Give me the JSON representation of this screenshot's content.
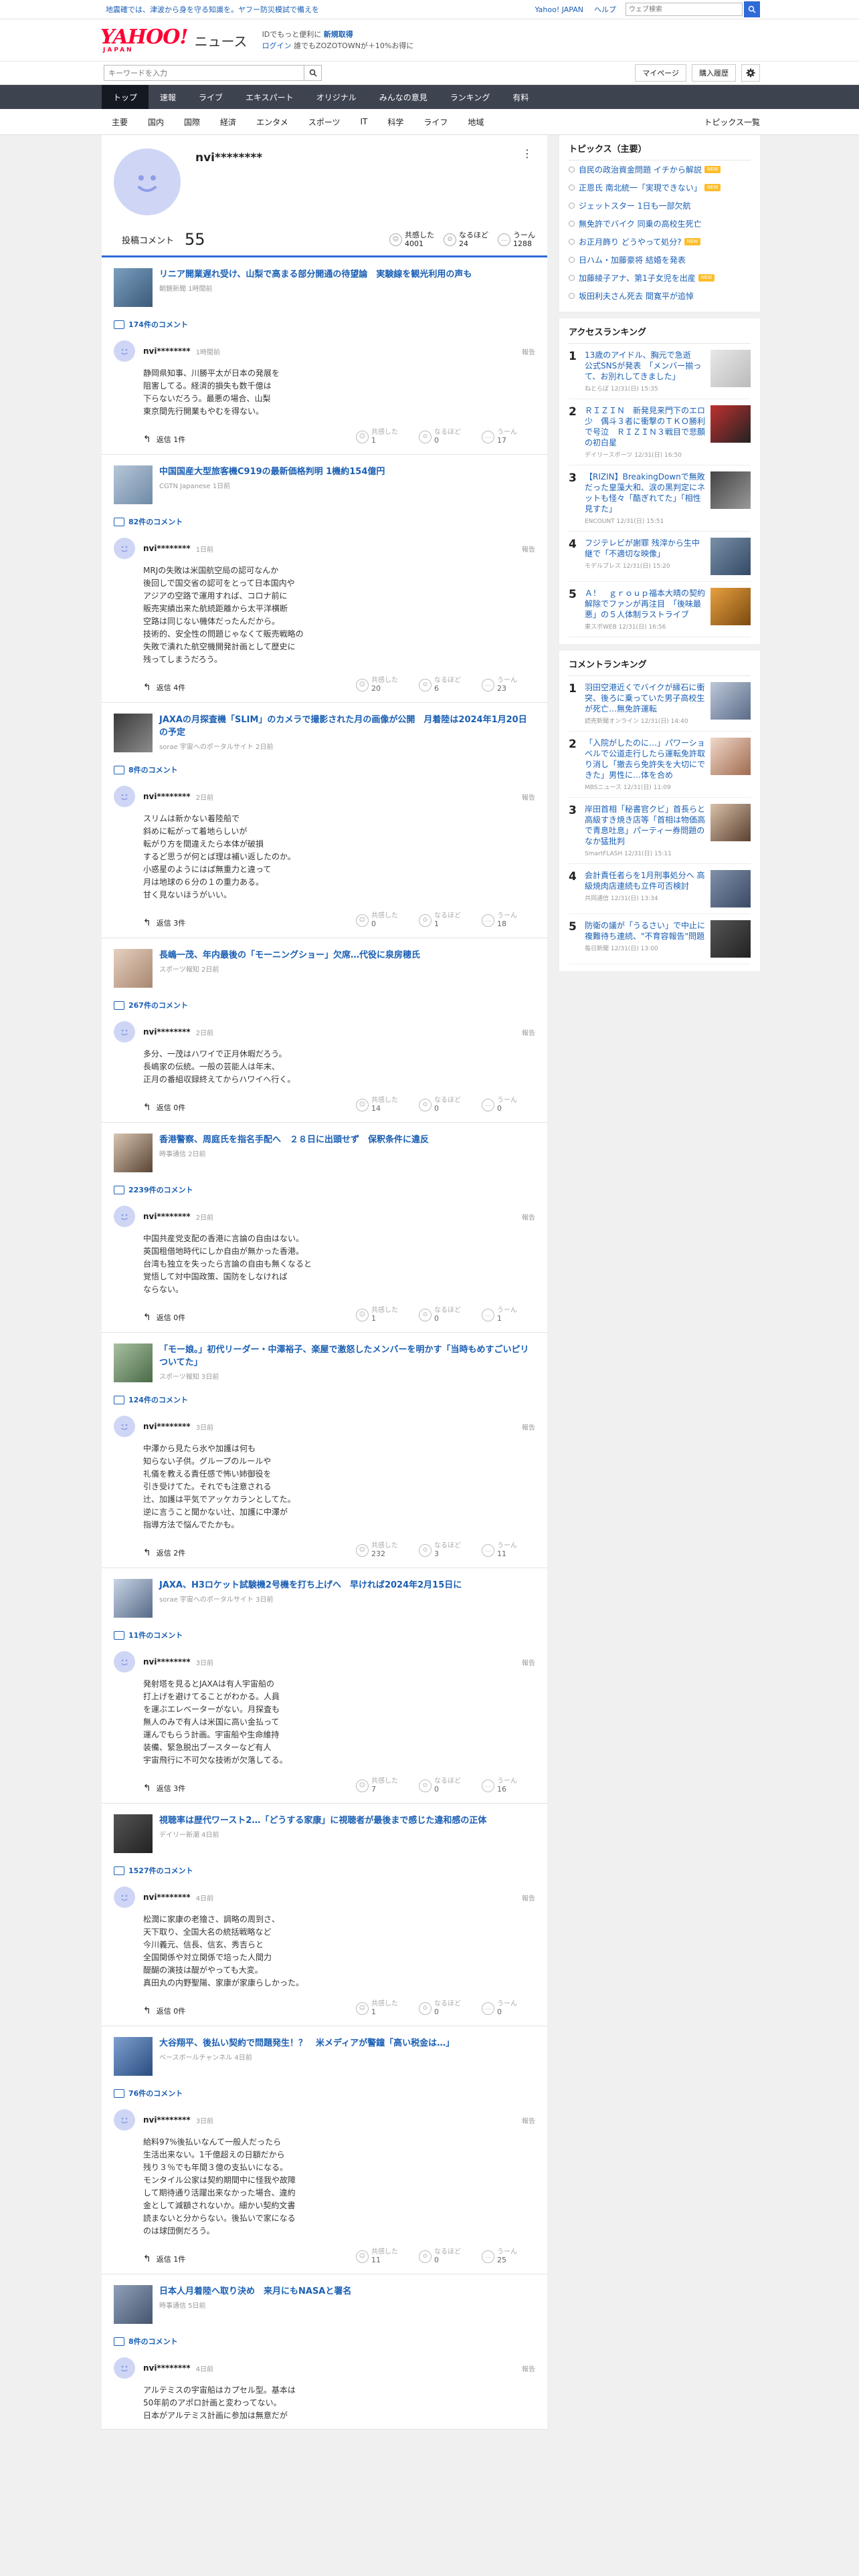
{
  "topbar": {
    "alert": "地震確では、津波から身を守る知識を。ヤフー防災模試で備えを",
    "link_yj": "Yahoo! JAPAN",
    "link_help": "ヘルプ",
    "search_placeholder": "ウェブ検索"
  },
  "header": {
    "logo_text": "YAHOO!",
    "logo_sub": "JAPAN",
    "section": "ニュース",
    "promo_line1_a": "IDでもっと便利に",
    "promo_line1_b": "新規取得",
    "promo_line2_a": "ログイン",
    "promo_line2_b": "誰でもZOZOTOWNが＋10%お得に"
  },
  "subbar": {
    "keyword_placeholder": "キーワードを入力",
    "mypage": "マイページ",
    "history": "購入履歴"
  },
  "nav": [
    "トップ",
    "速報",
    "ライブ",
    "エキスパート",
    "オリジナル",
    "みんなの意見",
    "ランキング",
    "有料"
  ],
  "cats": [
    "主要",
    "国内",
    "国際",
    "経済",
    "エンタメ",
    "スポーツ",
    "IT",
    "科学",
    "ライフ",
    "地域"
  ],
  "cats_all": "トピックス一覧",
  "profile": {
    "name": "nvi********",
    "posted_label": "投稿コメント",
    "posted_count": "55",
    "stats": [
      {
        "label": "共感した",
        "value": "4001"
      },
      {
        "label": "なるほど",
        "value": "24"
      },
      {
        "label": "うーん",
        "value": "1288"
      }
    ]
  },
  "reaction_labels": [
    "共感した",
    "なるほど",
    "うーん"
  ],
  "entries": [
    {
      "title": "リニア開業遅れ受け、山梨で高まる部分開通の待望論　実験線を観光利用の声も",
      "source": "朝鏡新聞 1時間前",
      "comments": "174件のコメント",
      "user": "nvi********",
      "time": "1時間前",
      "body": "静岡県知事、川勝平太が日本の発展を\n阻害してる。経済的損失も数千億は\n下らないだろう。最悪の場合、山梨\n東京間先行開業もやむを得ない。",
      "reply": "返信 1件",
      "reactions": [
        "1",
        "0",
        "17"
      ]
    },
    {
      "title": "中国国産大型旅客機C919の最新価格判明 1機約154億円",
      "source": "CGTN Japanese 1日前",
      "comments": "82件のコメント",
      "user": "nvi********",
      "time": "1日前",
      "body": "MRJの失敗は米国航空局の認可なんか\n後回しで国交省の認可をとって日本国内や\nアジアの空路で運用すれば、コロナ前に\n販売実績出来た航続距離から太平洋横断\n空路は同じない機体だったんだから。\n技術的、安全性の問題じゃなくて販売戦略の\n失敗で潰れた航空機開発計画として歴史に\n残ってしまうだろう。",
      "reply": "返信 4件",
      "reactions": [
        "20",
        "6",
        "23"
      ]
    },
    {
      "title": "JAXAの月探査機「SLIM」のカメラで撮影された月の画像が公開　月着陸は2024年1月20日の予定",
      "source": "sorae 宇宙へのポータルサイト 2日前",
      "comments": "8件のコメント",
      "user": "nvi********",
      "time": "2日前",
      "body": "スリムは新かない着陸船で\n斜めに転がって着地らしいが\n転がり方を間違えたら本体が破損\nするど思うが何とば理は補い返したのか。\n小惑星のようにはぱ無重力と違って\n月は地球の６分の１の重力ある。\n甘く見ないほうがいい。",
      "reply": "返信 3件",
      "reactions": [
        "0",
        "1",
        "18"
      ]
    },
    {
      "title": "長嶋一茂、年内最後の「モーニングショー」欠席…代役に泉房穂氏",
      "source": "スポーツ報知 2日前",
      "comments": "267件のコメント",
      "user": "nvi********",
      "time": "2日前",
      "body": "多分、一茂はハワイで正月休暇だろう。\n長嶋家の伝統。一般の芸能人は年末、\n正月の番組収録終えてからハワイへ行く。",
      "reply": "返信 0件",
      "reactions": [
        "14",
        "0",
        "0"
      ]
    },
    {
      "title": "香港警察、周庭氏を指名手配へ　２８日に出頭せず　保釈条件に違反",
      "source": "時事通信 2日前",
      "comments": "2239件のコメント",
      "user": "nvi********",
      "time": "2日前",
      "body": "中国共産党支配の香港に言論の自由はない。\n英国租借地時代にしか自由が無かった香港。\n台湾も独立を失ったら言論の自由も無くなると\n覚悟して対中国政策、国防をしなければ\nならない。",
      "reply": "返信 0件",
      "reactions": [
        "1",
        "0",
        "1"
      ]
    },
    {
      "title": "「モー娘。」初代リーダー・中澤裕子、楽屋で激怒したメンバーを明かす「当時もめすごいピリついてた」",
      "source": "スポーツ報知 3日前",
      "comments": "124件のコメント",
      "user": "nvi********",
      "time": "3日前",
      "body": "中澤から見たら氷や加護は何も\n知らない子供。グループのルールや\n礼儀を教える責任感で怖い姉御役を\n引き受けてた。それでも注意される\n辻、加護は平気でアッケカランとしてた。\n逆に言うこと聞かない辻、加護に中澤が\n指導方法で悩んでたかも。",
      "reply": "返信 2件",
      "reactions": [
        "232",
        "3",
        "11"
      ]
    },
    {
      "title": "JAXA、H3ロケット試験機2号機を打ち上げへ　早ければ2024年2月15日に",
      "source": "sorae 宇宙へのポータルサイト 3日前",
      "comments": "11件のコメント",
      "user": "nvi********",
      "time": "3日前",
      "body": "発射塔を見るとJAXAは有人宇宙船の\n打上げを避けてることがわかる。人員\nを運ぶエレベーターがない。月探査も\n無人のみで有人は米国に高い金払って\n運んでもらう計画。宇宙船や生命維持\n装備、緊急脱出ブースターなど有人\n宇宙飛行に不可欠な技術が欠落してる。",
      "reply": "返信 3件",
      "reactions": [
        "7",
        "0",
        "16"
      ]
    },
    {
      "title": "視聴率は歴代ワースト2…「どうする家康」に視聴者が最後まで感じた違和感の正体",
      "source": "デイリー新潮 4日前",
      "comments": "1527件のコメント",
      "user": "nvi********",
      "time": "4日前",
      "body": "松潤に家康の老獪さ、調略の周到さ、\n天下取り、全国大名の統括戦略など\n今川義元、信長、信玄、秀吉らと\n全国関係や対立関係で培った人間力\n醍醐の演技は醍がやっても大変。\n真田丸の内野聖陽、家康が家康らしかった。",
      "reply": "返信 0件",
      "reactions": [
        "1",
        "0",
        "0"
      ]
    },
    {
      "title": "大谷翔平、後払い契約で問題発生！？　米メディアが警鐘「高い税金は…」",
      "source": "ベースボールチャンネル 4日前",
      "comments": "76件のコメント",
      "user": "nvi********",
      "time": "3日前",
      "body": "給料97%後払いなんて一般人だったら\n生活出来ない。1千億超えの日額だから\n残り３％でも年間３億の支払いになる。\nモンタイル公家は契約期間中に怪我や故障\nして期待通り活躍出来なかった場合、違約\n金として減額されないか。細かい契約文書\n読まないと分からない。後払いで家になる\nのは球団側だろう。",
      "reply": "返信 1件",
      "reactions": [
        "11",
        "0",
        "25"
      ]
    },
    {
      "title": "日本人月着陸へ取り決め　来月にもNASAと署名",
      "source": "時事通信 5日前",
      "comments": "8件のコメント",
      "user": "nvi********",
      "time": "4日前",
      "body": "アルテミスの宇宙船はカプセル型。基本は\n50年前のアポロ計画と変わってない。\n日本がアルテミス計画に参加は無意だが",
      "reply": "",
      "reactions": [
        "",
        "",
        ""
      ]
    }
  ],
  "sidebar": {
    "topics_title": "トピックス（主要）",
    "topics": [
      {
        "text": "自民の政治資金問題 イチから解説",
        "badge": "NEW"
      },
      {
        "text": "正恩氏 南北統一「実現できない」",
        "badge": "NEW"
      },
      {
        "text": "ジェットスター 1日も一部欠航",
        "badge": ""
      },
      {
        "text": "無免許でバイク 同乗の高校生死亡",
        "badge": ""
      },
      {
        "text": "お正月飾り どうやって処分?",
        "badge": "NEW"
      },
      {
        "text": "日ハム・加藤豪将 結婚を発表",
        "badge": ""
      },
      {
        "text": "加藤綾子アナ、第1子女児を出産",
        "badge": "NEW"
      },
      {
        "text": "坂田利夫さん死去 間寛平が追悼",
        "badge": ""
      }
    ],
    "access_title": "アクセスランキング",
    "access": [
      {
        "title": "13歳のアイドル、胸元で急逝　公式SNSが発表　「メンバー揃って、お別れしてきました」",
        "src": "ねとらぼ 12/31(日) 15:35"
      },
      {
        "title": "ＲＩＺＩＮ　新発見来門下のエロ少　偶斗３者に衝撃のＴＫＯ勝利で号泣　ＲＩＺＩＮ３戦目で悲願の初白星",
        "src": "デイリースポーツ 12/31(日) 16:50"
      },
      {
        "title": "【RIZIN】BreakingDownで無敗だった皇藻大和、涙の黒判定にネットも怪々「酷ぎれてた」「相性見すた」",
        "src": "ENCOUNT 12/31(日) 15:51"
      },
      {
        "title": "フジテレビが謝罪 残滓から生中継で「不適切な映像」",
        "src": "モデルプレス 12/31(日) 15:20"
      },
      {
        "title": "Ａ！　ｇｒｏｕｐ福本大晴の契約解除でファンが再注目　「後味最悪」の５人体制ラストライブ",
        "src": "東スポWEB 12/31(日) 16:56"
      }
    ],
    "comment_title": "コメントランキング",
    "comment": [
      {
        "title": "羽田空港近くでバイクが縁石に衝突、後ろに乗っていた男子高校生が死亡…無免許運転",
        "src": "読売新聞オンライン 12/31(日) 14:40"
      },
      {
        "title": "「入院がしたのに…」パワーショベルで公道走行したら運転免許取り消し「撤去ら免許失を大切にできた」男性に…体を合め",
        "src": "MBSニュース 12/31(日) 11:09"
      },
      {
        "title": "岸田首相「秘書官クビ」首長らと高級すき焼き店等「首相は物価高で青息吐息」パーティー券問題のなか猛批判",
        "src": "SmartFLASH 12/31(日) 15:11"
      },
      {
        "title": "会計責任者らを1月刑事処分へ 高級焼肉店連続も立件可否検討",
        "src": "共同通信 12/31(日) 13:34"
      },
      {
        "title": "防衛の議が「うるさい」で中止に 複難待ち連続、\"不育容報告\"問題",
        "src": "毎日新聞 12/31(日) 13:00"
      }
    ]
  }
}
